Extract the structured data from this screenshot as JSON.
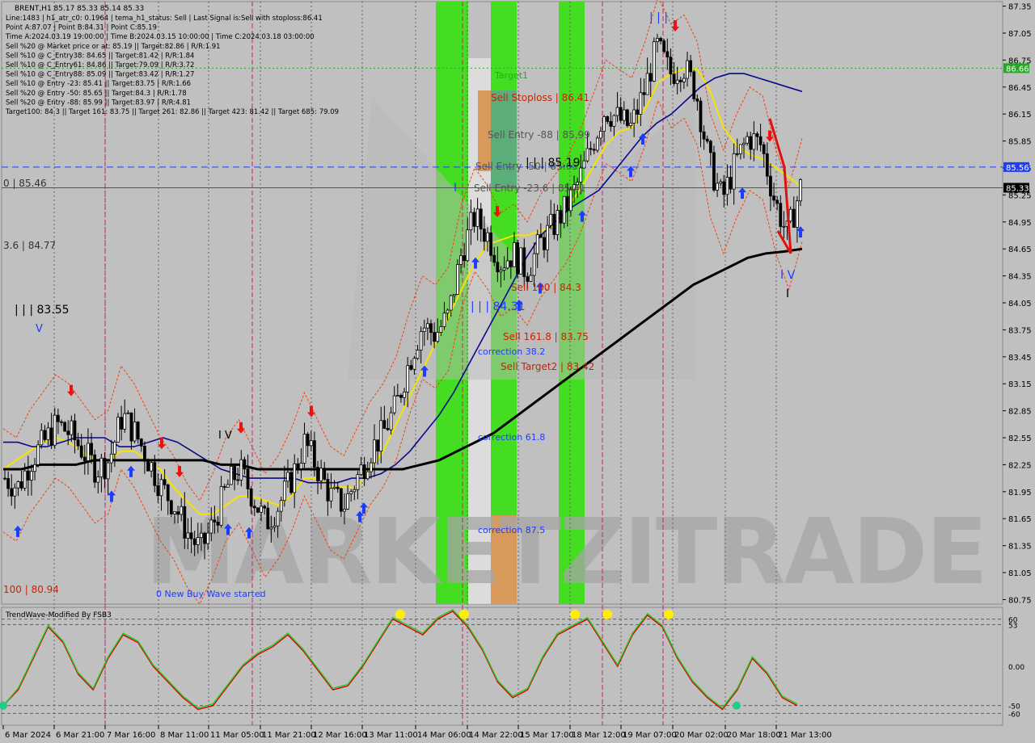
{
  "header": {
    "symbol_line": "BRENT,H1  85.17 85.33 85.14 85.33",
    "info_lines": [
      "Line:1483  |  h1_atr_c0: 0.1964  |  tema_h1_status: Sell  |  Last Signal is:Sell with stoploss:86.41",
      "Point A:87.07  |  Point B:84.31  |  Point C:85.19",
      "Time A:2024.03.19 19:00:00  |  Time B:2024.03.15 10:00:00  |  Time C:2024.03.18 03:00:00",
      "Sell %20 @ Market price or at: 85.19  ||  Target:82.86  |  R/R:1.91",
      "Sell %10 @ C_Entry38: 84.65  ||  Target:81.42  |  R/R:1.84",
      "Sell %10 @ C_Entry61: 84.86  ||  Target:79.09  |  R/R:3.72",
      "Sell %10 @ C_Entry88: 85.09  ||  Target:83.42  |  R/R:1.27",
      "Sell %10 @ Entry -23: 85.41  ||  Target:83.75  |  R/R:1.66",
      "Sell %20 @ Entry -50: 85.65  ||  Target:84.3  |  R/R:1.78",
      "Sell %20 @ Entry -88: 85.99  ||  Target:83.97  |  R/R:4.81",
      "Target100: 84.3  ||  Target 161: 83.75  ||  Target 261: 82.86  ||  Target 423: 81.42  ||  Target 685: 79.09"
    ]
  },
  "chart_data": {
    "type": "line",
    "symbol": "BRENT",
    "timeframe": "H1",
    "ylim": [
      80.7,
      87.4
    ],
    "y_ticks": [
      "87.35",
      "87.05",
      "86.75",
      "86.45",
      "86.15",
      "85.85",
      "85.55",
      "85.25",
      "84.95",
      "84.65",
      "84.35",
      "84.05",
      "83.75",
      "83.45",
      "83.15",
      "82.85",
      "82.55",
      "82.25",
      "81.95",
      "81.65",
      "81.35",
      "81.05",
      "80.75"
    ],
    "x_ticks": [
      "6 Mar 2024",
      "6 Mar 21:00",
      "7 Mar 16:00",
      "8 Mar 11:00",
      "11 Mar 05:00",
      "11 Mar 21:00",
      "12 Mar 16:00",
      "13 Mar 11:00",
      "14 Mar 06:00",
      "14 Mar 22:00",
      "15 Mar 17:00",
      "18 Mar 12:00",
      "19 Mar 07:00",
      "20 Mar 02:00",
      "20 Mar 18:00",
      "21 Mar 13:00"
    ],
    "current_price": "85.33",
    "price_tags": [
      {
        "value": 86.66,
        "label": "86.66",
        "color": "#22aa22"
      },
      {
        "value": 85.56,
        "label": "85.56",
        "color": "#1e3cff"
      },
      {
        "value": 85.33,
        "label": "85.33",
        "color": "#000000"
      }
    ],
    "close_series": [
      82.1,
      82.0,
      82.3,
      82.5,
      82.7,
      82.6,
      82.4,
      82.2,
      82.3,
      82.8,
      82.6,
      82.3,
      82.0,
      81.8,
      81.5,
      81.3,
      81.6,
      82.0,
      82.2,
      81.9,
      81.6,
      81.8,
      82.1,
      82.5,
      82.2,
      81.9,
      81.8,
      82.1,
      82.4,
      82.6,
      82.9,
      83.4,
      83.8,
      83.7,
      83.9,
      84.6,
      85.0,
      84.8,
      84.5,
      84.6,
      84.4,
      84.7,
      84.9,
      85.1,
      85.4,
      85.8,
      86.2,
      86.1,
      86.0,
      86.4,
      86.9,
      86.6,
      86.7,
      86.4,
      85.6,
      85.2,
      85.6,
      85.9,
      85.8,
      85.2,
      84.8,
      85.33
    ],
    "series": [
      {
        "name": "",
        "color": "#f5e400",
        "values": [
          82.2,
          82.3,
          82.4,
          82.5,
          82.55,
          82.5,
          82.4,
          82.3,
          82.3,
          82.4,
          82.4,
          82.3,
          82.2,
          82.0,
          81.85,
          81.7,
          81.7,
          81.8,
          81.9,
          81.9,
          81.85,
          81.8,
          81.9,
          82.1,
          82.1,
          82.0,
          82.0,
          82.0,
          82.2,
          82.4,
          82.7,
          83.0,
          83.3,
          83.6,
          83.9,
          84.2,
          84.5,
          84.7,
          84.75,
          84.8,
          84.8,
          84.85,
          84.9,
          85.1,
          85.3,
          85.55,
          85.8,
          85.95,
          86.0,
          86.2,
          86.5,
          86.6,
          86.65,
          86.65,
          86.4,
          86.0,
          85.8,
          85.7,
          85.65,
          85.55,
          85.45,
          85.33
        ]
      },
      {
        "name": "",
        "color": "#0a0a8c",
        "values": [
          82.5,
          82.5,
          82.45,
          82.45,
          82.5,
          82.55,
          82.55,
          82.55,
          82.45,
          82.45,
          82.5,
          82.55,
          82.5,
          82.4,
          82.3,
          82.2,
          82.15,
          82.1,
          82.1,
          82.1,
          82.1,
          82.05,
          82.05,
          82.05,
          82.1,
          82.1,
          82.15,
          82.25,
          82.4,
          82.6,
          82.8,
          83.05,
          83.35,
          83.65,
          83.95,
          84.25,
          84.55,
          84.8,
          84.95,
          85.1,
          85.2,
          85.3,
          85.5,
          85.7,
          85.9,
          86.05,
          86.15,
          86.3,
          86.45,
          86.55,
          86.6,
          86.6,
          86.55,
          86.5,
          86.45,
          86.4
        ]
      },
      {
        "name": "",
        "color": "#000000",
        "values": [
          82.2,
          82.2,
          82.25,
          82.25,
          82.25,
          82.3,
          82.3,
          82.3,
          82.3,
          82.3,
          82.3,
          82.3,
          82.25,
          82.25,
          82.2,
          82.2,
          82.2,
          82.2,
          82.2,
          82.2,
          82.2,
          82.2,
          82.2,
          82.25,
          82.3,
          82.4,
          82.5,
          82.6,
          82.75,
          82.9,
          83.05,
          83.2,
          83.35,
          83.5,
          83.65,
          83.8,
          83.95,
          84.1,
          84.25,
          84.35,
          84.45,
          84.55,
          84.6,
          84.62,
          84.65
        ]
      }
    ],
    "levels": [
      {
        "value": 86.66,
        "style": "dotted",
        "color": "#22aa22",
        "label": "Target1"
      },
      {
        "value": 85.56,
        "style": "dashed",
        "color": "#1e3cff",
        "label": ""
      },
      {
        "value": 85.33,
        "style": "solid",
        "color": "#555555",
        "label": ""
      }
    ],
    "annotations": [
      {
        "text": "Target1",
        "color": "#22aa22"
      },
      {
        "text": "Sell Stoploss | 86.41",
        "color": "#cc2200"
      },
      {
        "text": "Sell Entry -88 | 85.99",
        "color": "#555555"
      },
      {
        "text": "Sell Entry -50 | 85.65",
        "color": "#555555"
      },
      {
        "text": "Sell Entry -23.6 | 85.41",
        "color": "#555555"
      },
      {
        "text": "| | | 85.19",
        "color": "#000000"
      },
      {
        "text": "Sell 100 | 84.3",
        "color": "#cc2200"
      },
      {
        "text": "| | | 84.31",
        "color": "#1e3cff"
      },
      {
        "text": "Sell 161.8 | 83.75",
        "color": "#cc2200"
      },
      {
        "text": "correction 38.2",
        "color": "#1e3cff"
      },
      {
        "text": "Sell Target2 | 83.42",
        "color": "#cc2200"
      },
      {
        "text": "correction 61.8",
        "color": "#1e3cff"
      },
      {
        "text": "correction 87.5",
        "color": "#1e3cff"
      },
      {
        "text": "0 New Buy Wave started",
        "color": "#1e3cff"
      },
      {
        "text": "| | | 83.55",
        "color": "#000000"
      },
      {
        "text": "0 | 85.46",
        "color": "#333333"
      },
      {
        "text": "3.6 | 84.77",
        "color": "#333333"
      },
      {
        "text": "100 | 80.94",
        "color": "#cc2200"
      },
      {
        "text": "| | |",
        "color": "#1e3cff"
      },
      {
        "text": "I V",
        "color": "#1e3cff"
      },
      {
        "text": "V",
        "color": "#1e3cff"
      },
      {
        "text": "I V",
        "color": "#000000"
      },
      {
        "text": "I",
        "color": "#1e3cff"
      },
      {
        "text": "I",
        "color": "#000000"
      }
    ],
    "watermark": "MARKETZITRADE",
    "indicator": {
      "title": "TrendWave-Modified By FSB3",
      "ylim": [
        -75,
        75
      ],
      "y_ticks": [
        "60",
        "53",
        "0.00",
        "-50",
        "-60"
      ],
      "series": [
        {
          "name": "",
          "color": "#dd0000",
          "values": [
            -50,
            -30,
            10,
            50,
            30,
            -10,
            -30,
            10,
            40,
            30,
            0,
            -20,
            -40,
            -55,
            -50,
            -25,
            0,
            15,
            25,
            40,
            20,
            -5,
            -30,
            -25,
            0,
            30,
            60,
            50,
            40,
            60,
            70,
            50,
            20,
            -20,
            -40,
            -30,
            10,
            40,
            50,
            60,
            30,
            0,
            40,
            65,
            50,
            10,
            -20,
            -40,
            -55,
            -30,
            10,
            -10,
            -40,
            -50
          ]
        },
        {
          "name": "",
          "color": "#22cc22",
          "values": [
            -50,
            -28,
            12,
            52,
            32,
            -8,
            -28,
            12,
            42,
            32,
            2,
            -18,
            -38,
            -53,
            -48,
            -23,
            2,
            17,
            27,
            42,
            22,
            -3,
            -28,
            -23,
            2,
            32,
            62,
            52,
            42,
            62,
            72,
            52,
            22,
            -18,
            -38,
            -28,
            12,
            42,
            52,
            62,
            32,
            2,
            42,
            67,
            52,
            12,
            -18,
            -38,
            -53,
            -28,
            12,
            -8,
            -38,
            -48
          ]
        }
      ]
    }
  },
  "colors": {
    "background": "#c0c0c0",
    "bull_candle": "#000000",
    "bear_candle": "#000000",
    "green_zone": "#44dd22",
    "orange_zone": "#d89a5a",
    "buy_arrow": "#1e3cff",
    "sell_arrow": "#ee1111",
    "envelope": "#ee4411"
  }
}
